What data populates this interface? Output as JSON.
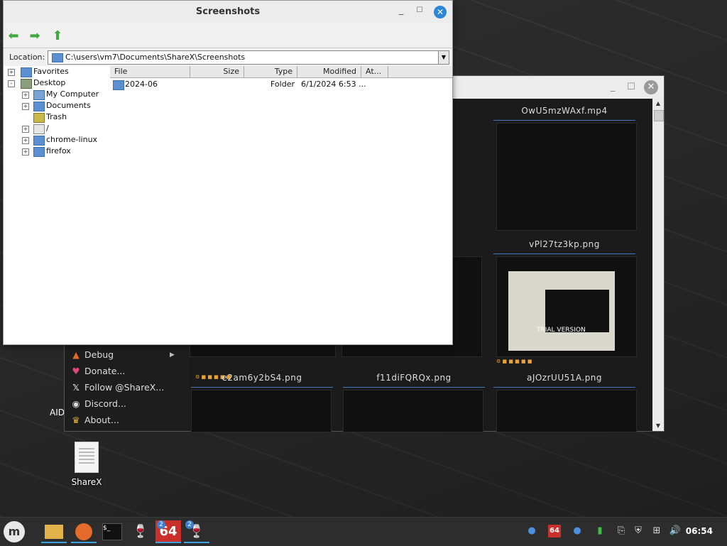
{
  "dialog": {
    "title": "Screenshots",
    "location_label": "Location:",
    "location_value": "C:\\users\\vm7\\Documents\\ShareX\\Screenshots",
    "tree": [
      {
        "label": "Favorites",
        "icon": "folder-icon",
        "expander": "+"
      },
      {
        "label": "Desktop",
        "icon": "desktop-icon",
        "expander": "-"
      },
      {
        "label": "My Computer",
        "icon": "computer-icon",
        "expander": "+"
      },
      {
        "label": "Documents",
        "icon": "folder-icon",
        "expander": "+"
      },
      {
        "label": "Trash",
        "icon": "trash-icon",
        "expander": ""
      },
      {
        "label": "/",
        "icon": "drive-icon",
        "expander": "+"
      },
      {
        "label": "chrome-linux",
        "icon": "folder-icon",
        "expander": "+"
      },
      {
        "label": "firefox",
        "icon": "folder-icon",
        "expander": "+"
      }
    ],
    "columns": [
      "File",
      "Size",
      "Type",
      "Modified",
      "At..."
    ],
    "rows": [
      {
        "name": "2024-06",
        "size": "",
        "type": "Folder",
        "modified": "6/1/2024 6:53 ..."
      }
    ]
  },
  "sharex": {
    "menu": [
      {
        "label": "Debug",
        "icon": "debug-icon",
        "submenu": true
      },
      {
        "label": "Donate...",
        "icon": "heart-icon",
        "submenu": false
      },
      {
        "label": "Follow @ShareX...",
        "icon": "x-logo-icon",
        "submenu": false
      },
      {
        "label": "Discord...",
        "icon": "discord-icon",
        "submenu": false
      },
      {
        "label": "About...",
        "icon": "crown-icon",
        "submenu": false
      }
    ],
    "thumbnails": [
      {
        "title": "OwU5mzWAxf.mp4"
      },
      {
        "title": "vPl27tz3kp.png",
        "overlay_text": "TRIAL VERSION"
      },
      {
        "title": "e2am6y2bS4.png"
      },
      {
        "title": "f11diFQRQx.png"
      },
      {
        "title": "aJOzrUU51A.png"
      }
    ],
    "partial_left_label": "AID"
  },
  "desktop": {
    "icons": [
      {
        "label": "ShareX"
      }
    ]
  },
  "taskbar": {
    "badges": [
      "2",
      "2"
    ],
    "wine_badge_text": "64",
    "tray_wine_text": "64",
    "clock": "06:54"
  },
  "colors": {
    "accent": "#2a87d8",
    "nav_green": "#3fa93f",
    "folder_blue": "#5b8fd1"
  }
}
